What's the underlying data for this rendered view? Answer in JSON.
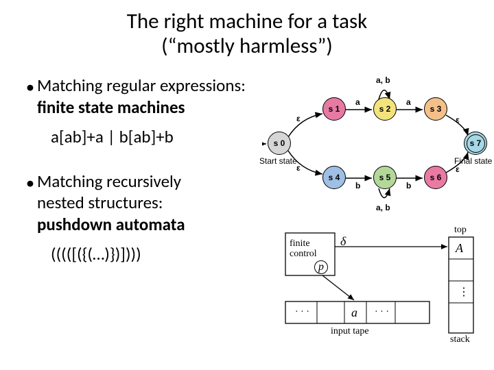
{
  "title_line1": "The right machine for a task",
  "title_line2": "(“mostly harmless”)",
  "bullet1": {
    "lead": "Matching regular expressions:",
    "strong": "finite state machines",
    "expr": "a[ab]+a | b[ab]+b"
  },
  "bullet2": {
    "lead": "Matching recursively",
    "lead2": "nested structures:",
    "strong": "pushdown automata",
    "expr": "(((([({(…)})])))"
  },
  "fsm": {
    "states": {
      "s0": "s 0",
      "s1": "s 1",
      "s2": "s 2",
      "s3": "s 3",
      "s4": "s 4",
      "s5": "s 5",
      "s6": "s 6",
      "s7": "s 7"
    },
    "labels": {
      "start": "Start state",
      "final": "Final state",
      "eps": "ε",
      "ab": "a, b",
      "a": "a",
      "b": "b"
    },
    "colors": {
      "s0": "#d6d6d6",
      "s1": "#e67aa2",
      "s2": "#f3e37c",
      "s3": "#f4c089",
      "s4": "#9fbfe4",
      "s5": "#b4d79a",
      "s6": "#e97aa3",
      "s7": "#a7d7e5"
    }
  },
  "pda": {
    "finite_control": "finite\ncontrol",
    "delta": "δ",
    "p": "p",
    "input_tape": "input tape",
    "stack": "stack",
    "top": "top",
    "A": "A",
    "a": "a",
    "dots": "· · ·",
    "vdots": "⋮"
  }
}
